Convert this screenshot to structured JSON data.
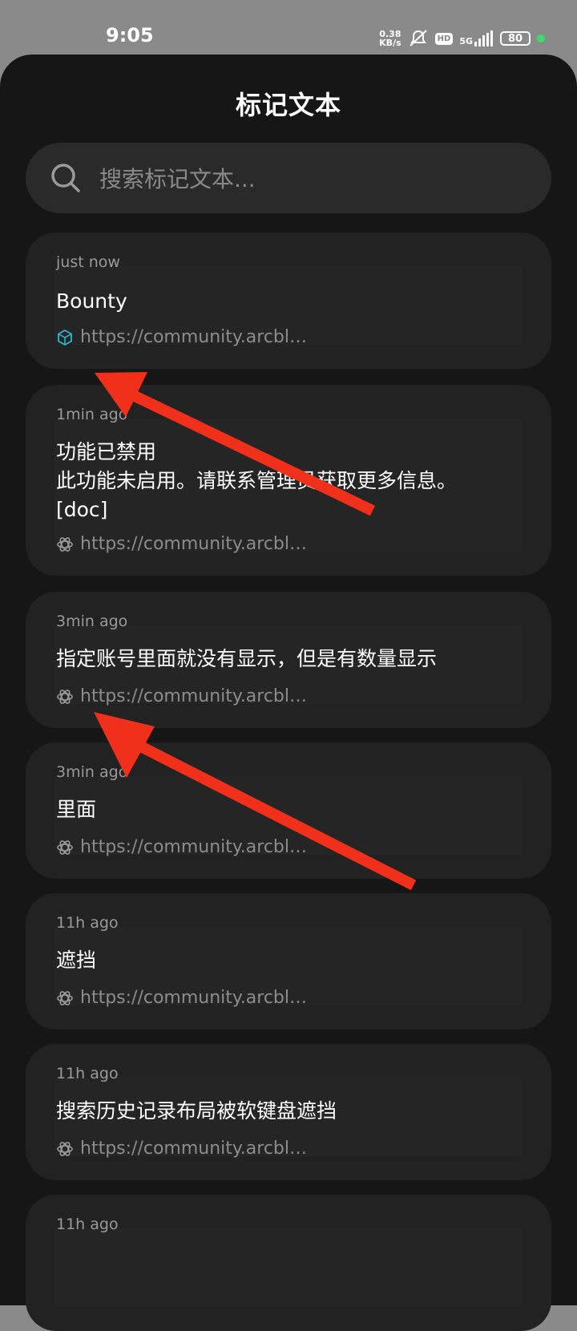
{
  "status": {
    "time": "9:05",
    "net_speed_value": "0.38",
    "net_speed_unit": "KB/s",
    "hd": "HD",
    "signal": "5G",
    "battery": "80"
  },
  "page": {
    "title": "标记文本",
    "search_placeholder": "搜索标记文本..."
  },
  "cards": [
    {
      "time": "just now",
      "text": "Bounty",
      "link": "https://community.arcbl…",
      "icon": "cube-icon"
    },
    {
      "time": "1min ago",
      "text": "功能已禁用\n此功能未启用。请联系管理员获取更多信息。\n[doc]",
      "link": "https://community.arcbl…",
      "icon": "atom-icon"
    },
    {
      "time": "3min ago",
      "text": "指定账号里面就没有显示，但是有数量显示",
      "link": "https://community.arcbl…",
      "icon": "atom-icon"
    },
    {
      "time": "3min ago",
      "text": "里面",
      "link": "https://community.arcbl…",
      "icon": "atom-icon"
    },
    {
      "time": "11h ago",
      "text": "遮挡",
      "link": "https://community.arcbl…",
      "icon": "atom-icon"
    },
    {
      "time": "11h ago",
      "text": "搜索历史记录布局被软键盘遮挡",
      "link": "https://community.arcbl…",
      "icon": "atom-icon"
    },
    {
      "time": "11h ago",
      "text": "",
      "link": "",
      "icon": ""
    }
  ],
  "colors": {
    "background": "#161616",
    "card": "#222222",
    "arrow": "#f0301a",
    "status_dot": "#3ddc6e"
  }
}
